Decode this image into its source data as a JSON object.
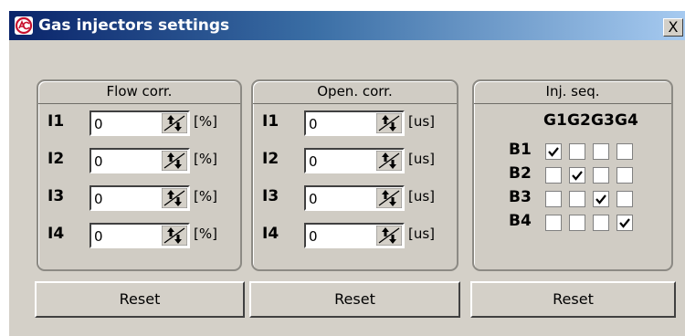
{
  "window": {
    "title": "Gas injectors settings",
    "close_label": "X"
  },
  "flow_panel": {
    "title": "Flow corr.",
    "rows": [
      {
        "label": "I1",
        "value": "0",
        "unit": "[%]"
      },
      {
        "label": "I2",
        "value": "0",
        "unit": "[%]"
      },
      {
        "label": "I3",
        "value": "0",
        "unit": "[%]"
      },
      {
        "label": "I4",
        "value": "0",
        "unit": "[%]"
      }
    ],
    "reset_label": "Reset"
  },
  "open_panel": {
    "title": "Open. corr.",
    "rows": [
      {
        "label": "I1",
        "value": "0",
        "unit": "[us]"
      },
      {
        "label": "I2",
        "value": "0",
        "unit": "[us]"
      },
      {
        "label": "I3",
        "value": "0",
        "unit": "[us]"
      },
      {
        "label": "I4",
        "value": "0",
        "unit": "[us]"
      }
    ],
    "reset_label": "Reset"
  },
  "seq_panel": {
    "title": "Inj. seq.",
    "columns": [
      "G1",
      "G2",
      "G3",
      "G4"
    ],
    "rows": [
      {
        "label": "B1",
        "checked": [
          true,
          false,
          false,
          false
        ]
      },
      {
        "label": "B2",
        "checked": [
          false,
          true,
          false,
          false
        ]
      },
      {
        "label": "B3",
        "checked": [
          false,
          false,
          true,
          false
        ]
      },
      {
        "label": "B4",
        "checked": [
          false,
          false,
          false,
          true
        ]
      }
    ],
    "reset_label": "Reset"
  },
  "icons": {
    "app": "ac-logo-icon",
    "spin": "up-down-arrows-icon",
    "check": "checkmark-icon"
  },
  "colors": {
    "titlebar_start": "#0a246a",
    "titlebar_end": "#a6caf0",
    "window_face": "#d4d0c8",
    "panel_face": "#d0ccc4"
  }
}
